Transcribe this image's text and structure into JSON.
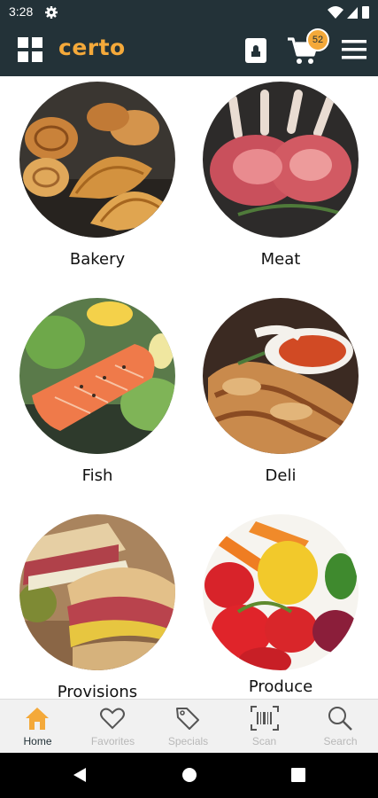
{
  "status_bar": {
    "time": "3:28"
  },
  "app_bar": {
    "logo": "certo",
    "cart_count": "52"
  },
  "categories": [
    {
      "label": "Bakery"
    },
    {
      "label": "Meat"
    },
    {
      "label": "Fish"
    },
    {
      "label": "Deli"
    },
    {
      "label": "Provisions"
    },
    {
      "label": "Produce"
    }
  ],
  "bottom_nav": {
    "items": [
      {
        "label": "Home",
        "icon": "home-icon",
        "active": true
      },
      {
        "label": "Favorites",
        "icon": "heart-icon",
        "active": false
      },
      {
        "label": "Specials",
        "icon": "tag-icon",
        "active": false
      },
      {
        "label": "Scan",
        "icon": "barcode-icon",
        "active": false
      },
      {
        "label": "Search",
        "icon": "search-icon",
        "active": false
      }
    ]
  },
  "colors": {
    "header": "#233238",
    "accent": "#f4a93a"
  }
}
